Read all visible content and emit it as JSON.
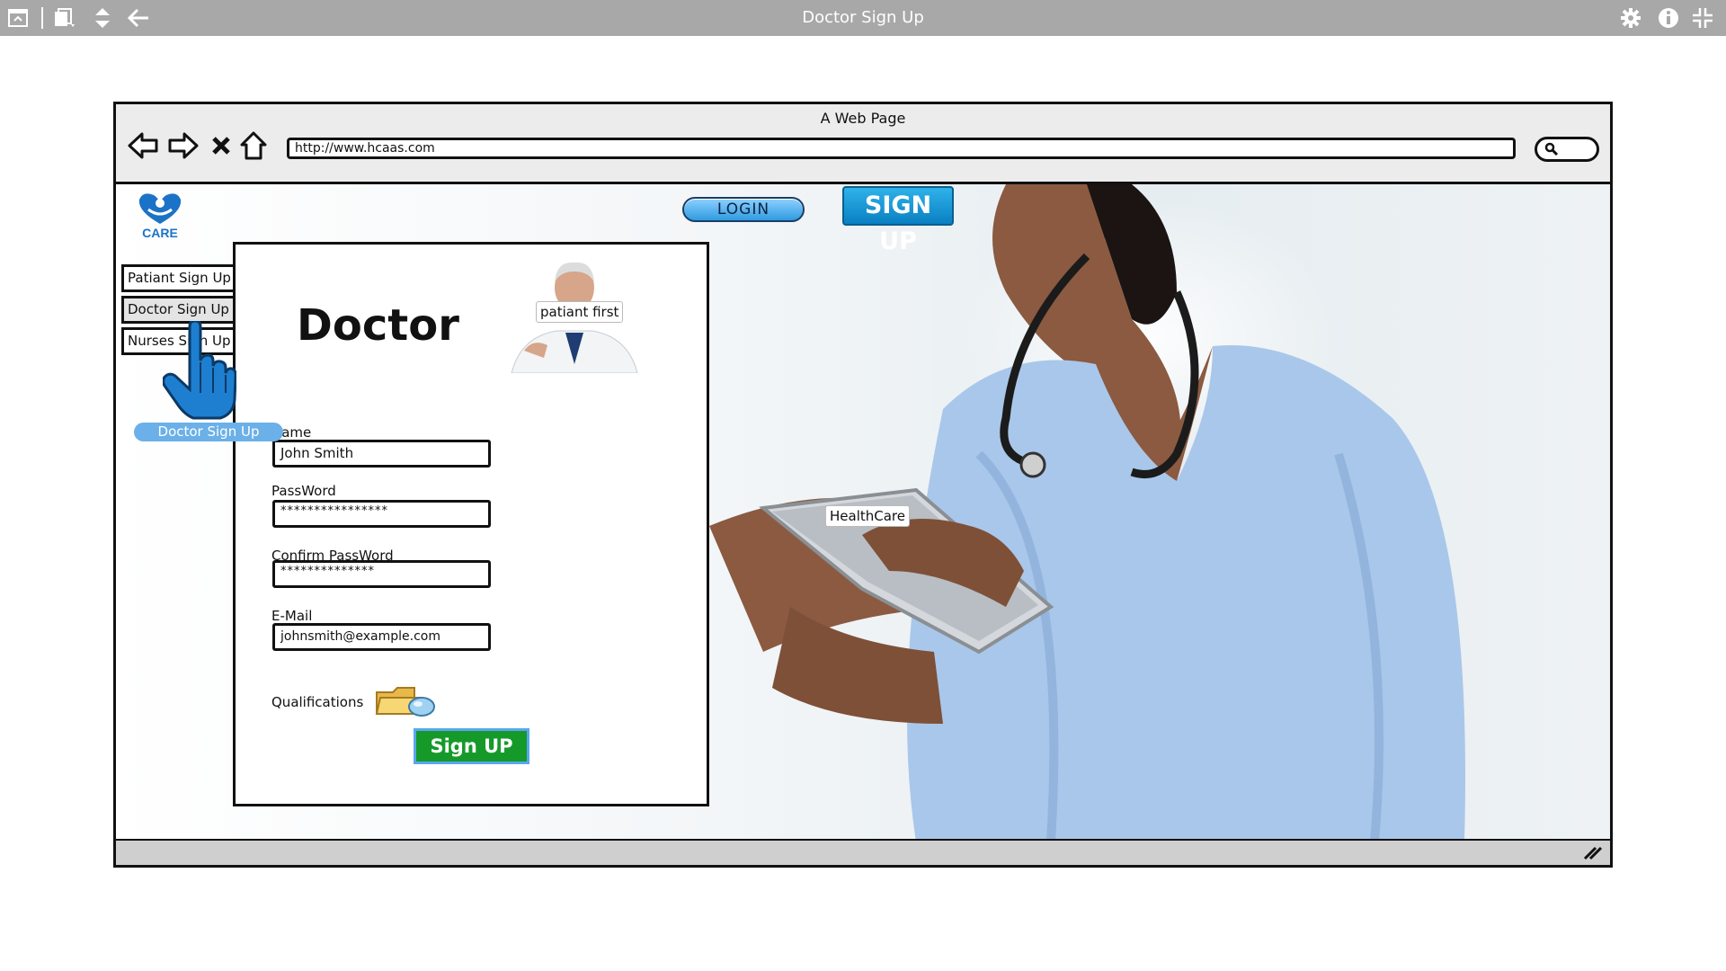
{
  "app": {
    "title": "Doctor Sign Up",
    "toolbar_icons": [
      "window-icon",
      "copy-icon",
      "reorder-icon",
      "back-arrow-icon"
    ],
    "right_icons": [
      "gear-icon",
      "info-icon",
      "collapse-icon"
    ]
  },
  "browser": {
    "title": "A Web Page",
    "url": "http://www.hcaas.com",
    "nav_icons": [
      "back-icon",
      "forward-icon",
      "stop-icon",
      "home-icon",
      "search-icon"
    ]
  },
  "site": {
    "logo_text": "CARE",
    "login_label": "LOGIN",
    "signup_label": "SIGN UP"
  },
  "tabs": [
    {
      "label": "Patiant Sign Up"
    },
    {
      "label": "Doctor Sign Up"
    },
    {
      "label": "Nurses Sign Up"
    }
  ],
  "tooltip": "Doctor Sign Up",
  "form": {
    "heading": "Doctor",
    "photo_label": "patiant first",
    "name_label": "Name",
    "name_value": "John Smith",
    "password_label": "PassWord",
    "password_value": "****************",
    "confirm_label": "Confirm PassWord",
    "confirm_value": "**************",
    "email_label": "E-Mail",
    "email_value": "johnsmith@example.com",
    "qualifications_label": "Qualifications",
    "submit_label": "Sign UP"
  },
  "hero": {
    "label": "HealthCare"
  },
  "colors": {
    "appbar": "#a8a8a8",
    "signup_blue": "#0a80c2",
    "submit_green": "#159a2a",
    "tooltip_blue": "#6bb0e8",
    "scrubs": "#a9c7ea"
  }
}
